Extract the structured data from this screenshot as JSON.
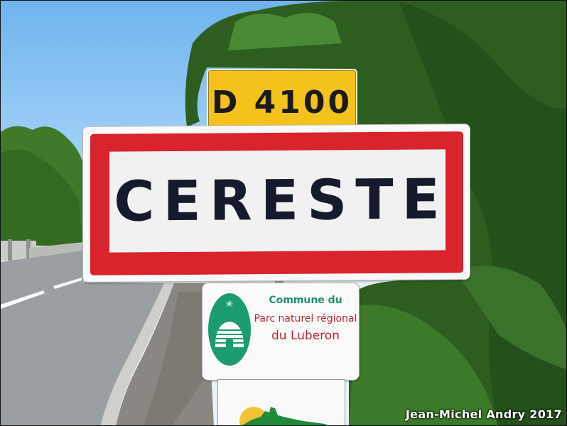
{
  "signs": {
    "route_number": "D 4100",
    "town_name": "CERESTE",
    "park_sign": {
      "line1": "Commune du",
      "line2": "Parc naturel régional",
      "line3": "du Luberon"
    }
  },
  "photo_credit": "Jean-Michel Andry 2017",
  "colors": {
    "route_plate": "#f4c21b",
    "town_sign_border": "#d9232d",
    "town_sign_text": "#151a2c",
    "park_green": "#1c9a72",
    "park_red": "#c4242e",
    "foliage": "#2d5e1f",
    "road": "#9a9fa3"
  },
  "icons": [
    "park-logo-icon",
    "village-silhouette-icon"
  ]
}
